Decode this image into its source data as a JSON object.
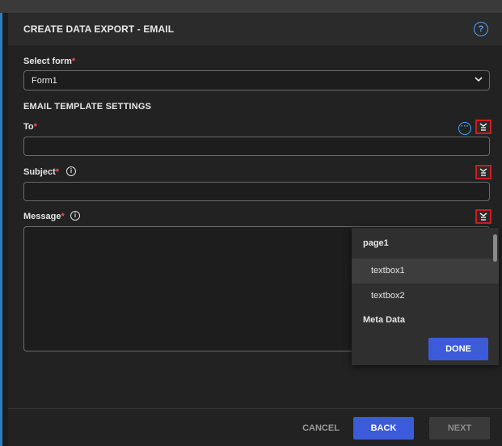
{
  "dialog": {
    "title": "CREATE DATA EXPORT - EMAIL",
    "help_symbol": "?"
  },
  "select_form": {
    "label": "Select form",
    "required_mark": "*",
    "value": "Form1",
    "chevron": "⌄"
  },
  "email_template": {
    "heading": "EMAIL TEMPLATE SETTINGS",
    "to": {
      "label": "To",
      "required_mark": "*",
      "value": "",
      "more_symbol": "···"
    },
    "subject": {
      "label": "Subject",
      "required_mark": "*",
      "info_symbol": "i",
      "value": ""
    },
    "message": {
      "label": "Message",
      "required_mark": "*",
      "info_symbol": "i",
      "value": ""
    }
  },
  "field_panel": {
    "groups": [
      {
        "label": "page1",
        "items": [
          "textbox1",
          "textbox2"
        ]
      },
      {
        "label": "Meta Data",
        "items": []
      }
    ],
    "done_label": "DONE"
  },
  "footer": {
    "cancel_label": "CANCEL",
    "back_label": "BACK",
    "next_label": "NEXT"
  },
  "colors": {
    "accent": "#3b5bdb",
    "required": "#ff4d4d",
    "highlight": "#d11b1b",
    "link": "#4aa3ff"
  }
}
